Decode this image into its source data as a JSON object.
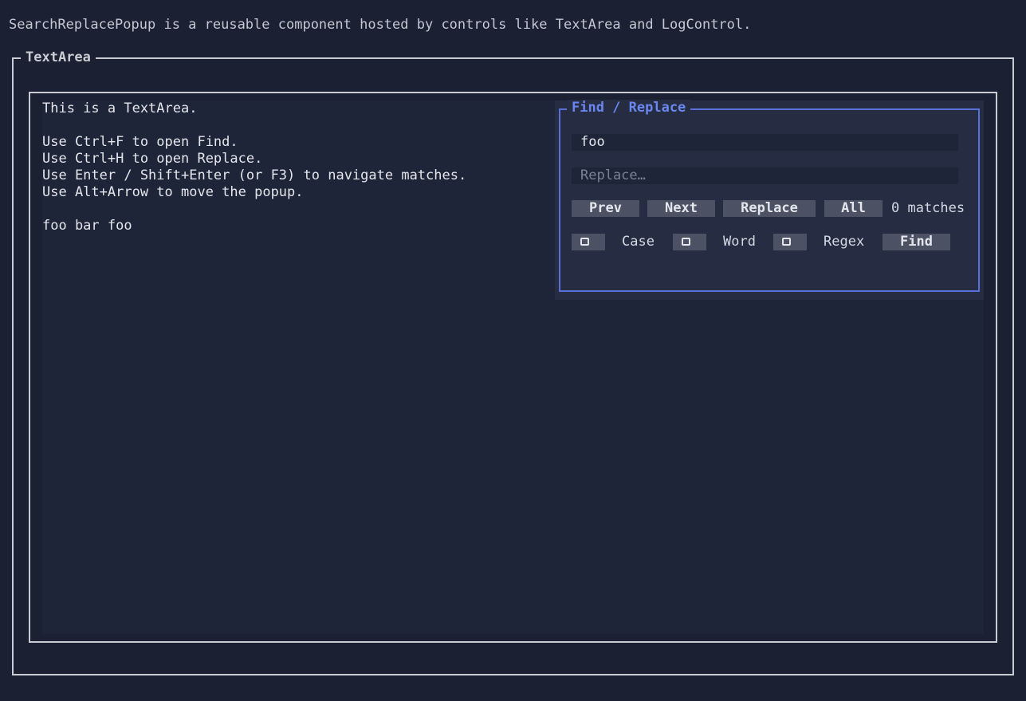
{
  "description": "SearchReplacePopup is a reusable component hosted by controls like TextArea and LogControl.",
  "text_area": {
    "title": "TextArea",
    "lines": [
      "This is a TextArea.",
      "Use Ctrl+F to open Find.",
      "Use Ctrl+H to open Replace.",
      "Use Enter / Shift+Enter (or F3) to navigate matches.",
      "Use Alt+Arrow to move the popup.",
      "foo bar foo"
    ]
  },
  "popup": {
    "title": "Find / Replace",
    "find_value": "foo",
    "replace_value": "",
    "replace_placeholder": "Replace…",
    "buttons": {
      "prev": "Prev",
      "next": "Next",
      "replace": "Replace",
      "all": "All",
      "find": "Find"
    },
    "match_count": "0 matches",
    "options": {
      "case": {
        "label": "Case",
        "checked": false
      },
      "word": {
        "label": "Word",
        "checked": false
      },
      "regex": {
        "label": "Regex",
        "checked": false
      }
    }
  },
  "colors": {
    "background": "#1b2133",
    "editor_background": "#1f2538",
    "popup_background": "#262d42",
    "popup_accent": "#5870d8",
    "button_background": "#4c5264",
    "frame": "#c9ccd3"
  }
}
